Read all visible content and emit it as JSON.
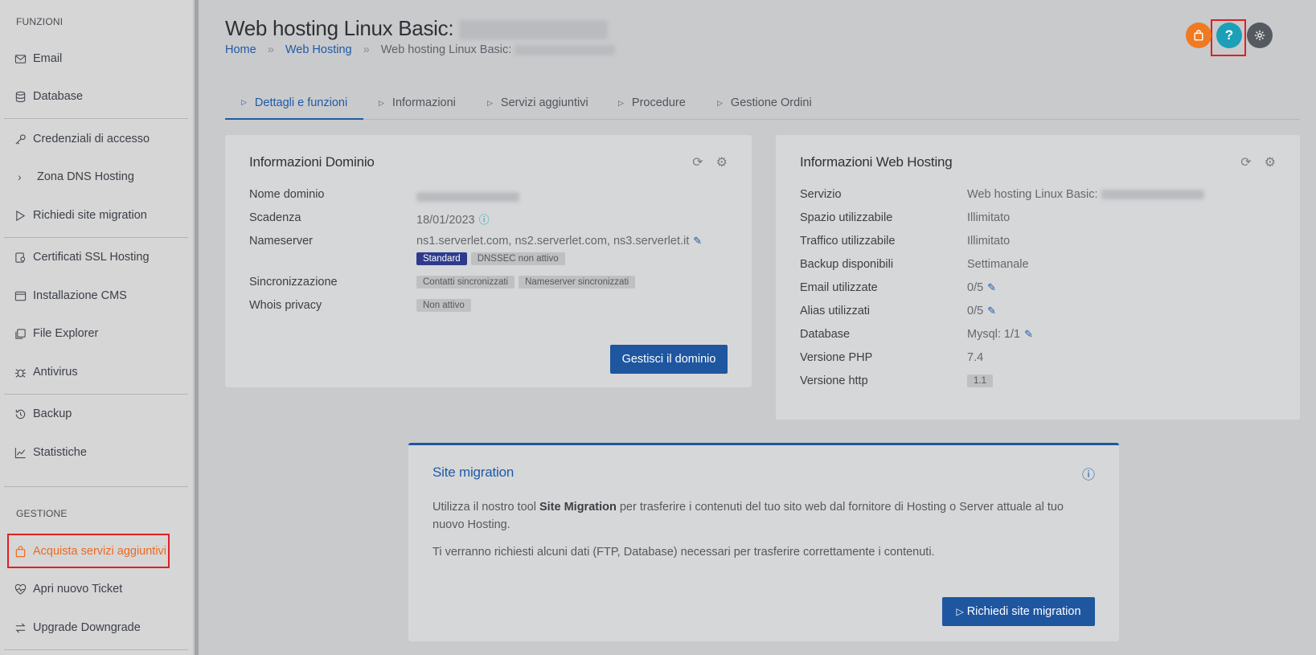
{
  "sidebar": {
    "section_funzioni": "FUNZIONI",
    "section_gestione": "GESTIONE",
    "items": [
      {
        "label": "Email",
        "icon": "mail-icon"
      },
      {
        "label": "Database",
        "icon": "database-icon"
      },
      {
        "label": "Credenziali di accesso",
        "icon": "key-icon"
      },
      {
        "label": "Zona DNS Hosting",
        "icon": "chevron-right-icon"
      },
      {
        "label": "Richiedi site migration",
        "icon": "play-icon"
      },
      {
        "label": "Certificati SSL Hosting",
        "icon": "certificate-icon"
      },
      {
        "label": "Installazione CMS",
        "icon": "window-icon"
      },
      {
        "label": "File Explorer",
        "icon": "files-icon"
      },
      {
        "label": "Antivirus",
        "icon": "bug-icon"
      },
      {
        "label": "Backup",
        "icon": "history-icon"
      },
      {
        "label": "Statistiche",
        "icon": "chart-icon"
      },
      {
        "label": "Acquista servizi aggiuntivi",
        "icon": "bag-icon"
      },
      {
        "label": "Apri nuovo Ticket",
        "icon": "heartbeat-icon"
      },
      {
        "label": "Upgrade Downgrade",
        "icon": "swap-icon"
      }
    ]
  },
  "header": {
    "title": "Web hosting Linux Basic:",
    "breadcrumb": [
      "Home",
      "Web Hosting",
      "Web hosting Linux Basic:"
    ],
    "breadcrumb_sep": "»",
    "icons": {
      "cart": "bag-icon",
      "help": "?",
      "settings": "gear-icon"
    },
    "colors": {
      "cart": "#f07a22",
      "help": "#1ba0b7",
      "settings": "#555a60"
    }
  },
  "tabs": [
    "Dettagli e funzioni",
    "Informazioni",
    "Servizi aggiuntivi",
    "Procedure",
    "Gestione Ordini"
  ],
  "domain_card": {
    "title": "Informazioni Dominio",
    "labels": [
      "Nome dominio",
      "Scadenza",
      "Nameserver",
      "Sincronizzazione",
      "Whois privacy"
    ],
    "scadenza": "18/01/2023",
    "nameserver": "ns1.serverlet.com, ns2.serverlet.com, ns3.serverlet.it",
    "badge_standard": "Standard",
    "badge_dnssec": "DNSSEC non attivo",
    "badge_contatti": "Contatti sincronizzati",
    "badge_ns": "Nameserver sincronizzati",
    "badge_whois": "Non attivo",
    "button": "Gestisci il dominio"
  },
  "hosting_card": {
    "title": "Informazioni Web Hosting",
    "rows": [
      {
        "label": "Servizio",
        "value": "Web hosting Linux Basic:"
      },
      {
        "label": "Spazio utilizzabile",
        "value": "Illimitato"
      },
      {
        "label": "Traffico utilizzabile",
        "value": "Illimitato"
      },
      {
        "label": "Backup disponibili",
        "value": "Settimanale"
      },
      {
        "label": "Email utilizzate",
        "value": "0/5"
      },
      {
        "label": "Alias utilizzati",
        "value": "0/5"
      },
      {
        "label": "Database",
        "value": "Mysql: 1/1"
      },
      {
        "label": "Versione PHP",
        "value": "7.4"
      },
      {
        "label": "Versione http",
        "value": "1.1"
      }
    ]
  },
  "migration_card": {
    "title": "Site migration",
    "text1_a": "Utilizza il nostro tool ",
    "text1_b": "Site Migration",
    "text1_c": " per trasferire i contenuti del tuo sito web dal fornitore di Hosting o Server attuale al tuo nuovo Hosting.",
    "text2": "Ti verranno richiesti alcuni dati (FTP, Database) necessari per trasferire correttamente i contenuti.",
    "button": "Richiedi site migration"
  }
}
